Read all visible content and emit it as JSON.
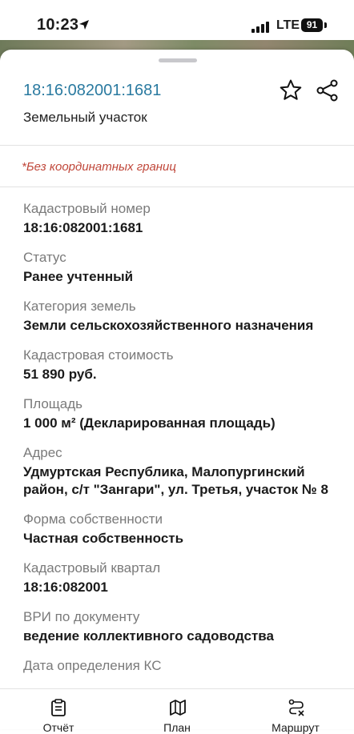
{
  "status_bar": {
    "time": "10:23",
    "network": "LTE",
    "battery": "91"
  },
  "header": {
    "cadastral_id": "18:16:082001:1681",
    "object_type": "Земельный участок",
    "warning": "*Без координатных границ"
  },
  "fields": [
    {
      "label": "Кадастровый номер",
      "value": "18:16:082001:1681"
    },
    {
      "label": "Статус",
      "value": "Ранее учтенный"
    },
    {
      "label": "Категория земель",
      "value": "Земли сельскохозяйственного назначения"
    },
    {
      "label": "Кадастровая стоимость",
      "value": "51 890 руб."
    },
    {
      "label": "Площадь",
      "value": "1 000 м² (Декларированная площадь)"
    },
    {
      "label": "Адрес",
      "value": "Удмуртская Республика, Малопургинский район, с/т \"Зангари\", ул. Третья, участок № 8"
    },
    {
      "label": "Форма собственности",
      "value": "Частная собственность"
    },
    {
      "label": "Кадастровый квартал",
      "value": "18:16:082001"
    },
    {
      "label": "ВРИ по документу",
      "value": "ведение коллективного садоводства"
    },
    {
      "label": "Дата определения КС",
      "value": ""
    }
  ],
  "tabs": [
    {
      "label": "Отчёт",
      "icon": "report-icon"
    },
    {
      "label": "План",
      "icon": "map-icon"
    },
    {
      "label": "Маршрут",
      "icon": "route-icon"
    }
  ],
  "colors": {
    "title": "#2a7aa0",
    "warning": "#c0473a",
    "label": "#7a7a7a"
  }
}
